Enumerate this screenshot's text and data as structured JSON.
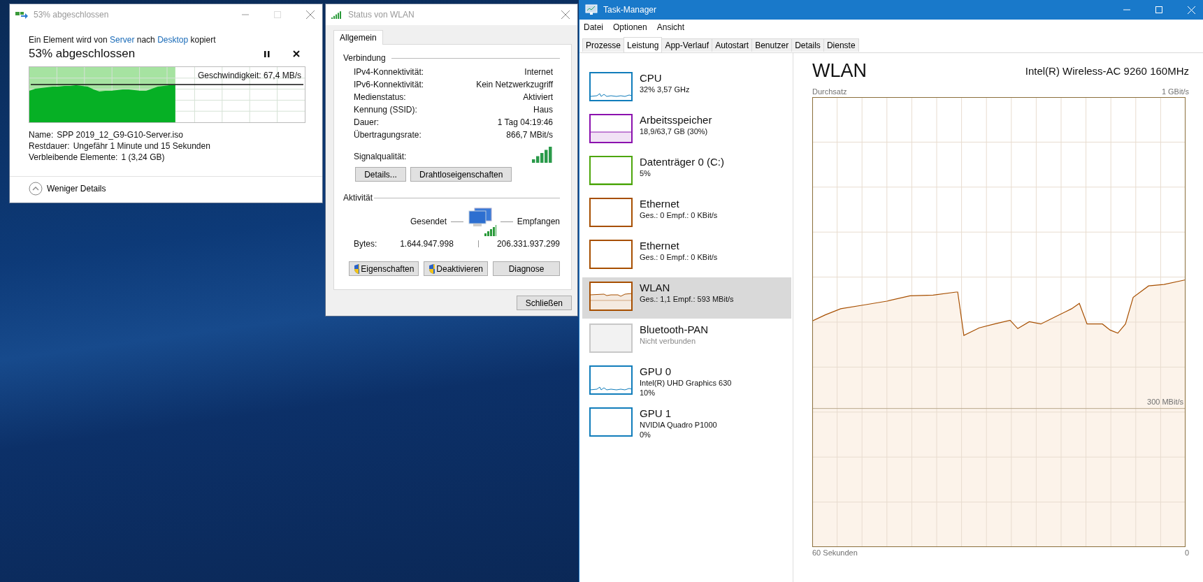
{
  "copy_dialog": {
    "title": "53% abgeschlossen",
    "message": [
      {
        "text": "Ein Element wird von",
        "link": false
      },
      {
        "text": "Server",
        "link": true
      },
      {
        "text": "nach",
        "link": false
      },
      {
        "text": "Desktop",
        "link": true
      },
      {
        "text": "kopiert",
        "link": false
      }
    ],
    "heading": "53% abgeschlossen",
    "progress": {
      "level": 0.53,
      "speed": "Geschwindigkeit: 67,4 MB/s"
    },
    "details": [
      {
        "label": "Name:",
        "value": "SPP 2019_12_G9-G10-Server.iso"
      },
      {
        "label": "Restdauer:",
        "value": "Ungefähr 1 Minute und 15 Sekunden"
      },
      {
        "label": "Verbleibende Elemente:",
        "value": "1 (3,24 GB)"
      }
    ],
    "toggle": "Weniger Details"
  },
  "wlan_status": {
    "title": "Status von WLAN",
    "tabs": [
      {
        "label": "Allgemein",
        "selected": true
      }
    ],
    "connection": {
      "heading": "Verbindung",
      "rows": [
        {
          "label": "IPv4-Konnektivität:",
          "value": "Internet"
        },
        {
          "label": "IPv6-Konnektivität:",
          "value": "Kein Netzwerkzugriff"
        },
        {
          "label": "Medienstatus:",
          "value": "Aktiviert"
        },
        {
          "label": "Kennung (SSID):",
          "value": "Haus"
        },
        {
          "label": "Dauer:",
          "value": "1 Tag 04:19:46"
        },
        {
          "label": "Übertragungsrate:",
          "value": "866,7 MBit/s"
        }
      ],
      "signal_label": "Signalqualität:",
      "buttons": [
        "Details...",
        "Drahtloseigenschaften"
      ]
    },
    "activity": {
      "heading": "Aktivität",
      "sent_label": "Gesendet",
      "received_label": "Empfangen",
      "bytes_label": "Bytes:",
      "bytes_sent": "1.644.947.998",
      "bytes_received": "206.331.937.299"
    },
    "buttons": [
      {
        "label": "Eigenschaften",
        "shield": true
      },
      {
        "label": "Deaktivieren",
        "shield": true
      },
      {
        "label": "Diagnose",
        "shield": false
      }
    ],
    "close_button": "Schließen"
  },
  "task_manager": {
    "title": "Task-Manager",
    "menu": [
      "Datei",
      "Optionen",
      "Ansicht"
    ],
    "tabs": [
      {
        "label": "Prozesse",
        "selected": false
      },
      {
        "label": "Leistung",
        "selected": true
      },
      {
        "label": "App-Verlauf",
        "selected": false
      },
      {
        "label": "Autostart",
        "selected": false
      },
      {
        "label": "Benutzer",
        "selected": false
      },
      {
        "label": "Details",
        "selected": false
      },
      {
        "label": "Dienste",
        "selected": false
      }
    ],
    "sidebar": [
      {
        "name": "CPU",
        "lines": [
          "32%  3,57 GHz"
        ],
        "color": "#117dbb",
        "kind": "line",
        "selected": false
      },
      {
        "name": "Arbeitsspeicher",
        "lines": [
          "18,9/63,7 GB (30%)"
        ],
        "color": "#8b12ae",
        "kind": "memory",
        "selected": false
      },
      {
        "name": "Datenträger 0 (C:)",
        "lines": [
          "5%"
        ],
        "color": "#4da60c",
        "kind": "flat",
        "selected": false
      },
      {
        "name": "Ethernet",
        "lines": [
          "Ges.: 0 Empf.: 0 KBit/s"
        ],
        "color": "#a74f01",
        "kind": "empty",
        "selected": false
      },
      {
        "name": "Ethernet",
        "lines": [
          "Ges.: 0 Empf.: 0 KBit/s"
        ],
        "color": "#a74f01",
        "kind": "empty",
        "selected": false
      },
      {
        "name": "WLAN",
        "lines": [
          "Ges.: 1,1 Empf.: 593 MBit/s"
        ],
        "color": "#a74f01",
        "kind": "area",
        "selected": true
      },
      {
        "name": "Bluetooth-PAN",
        "lines": [
          "Nicht verbunden"
        ],
        "color": "#c8c8c8",
        "kind": "off",
        "selected": false
      },
      {
        "name": "GPU 0",
        "lines": [
          "Intel(R) UHD Graphics 630",
          "10%"
        ],
        "color": "#117dbb",
        "kind": "line",
        "selected": false
      },
      {
        "name": "GPU 1",
        "lines": [
          "NVIDIA Quadro P1000",
          "0%"
        ],
        "color": "#117dbb",
        "kind": "empty",
        "selected": false
      }
    ],
    "detail": {
      "title": "WLAN",
      "adapter": "Intel(R) Wireless-AC 9260 160MHz",
      "graph_label": "Durchsatz",
      "top_label": "1 GBit/s",
      "mid_label": "300 MBit/s",
      "left_label": "60 Sekunden",
      "right_label": "0"
    }
  }
}
